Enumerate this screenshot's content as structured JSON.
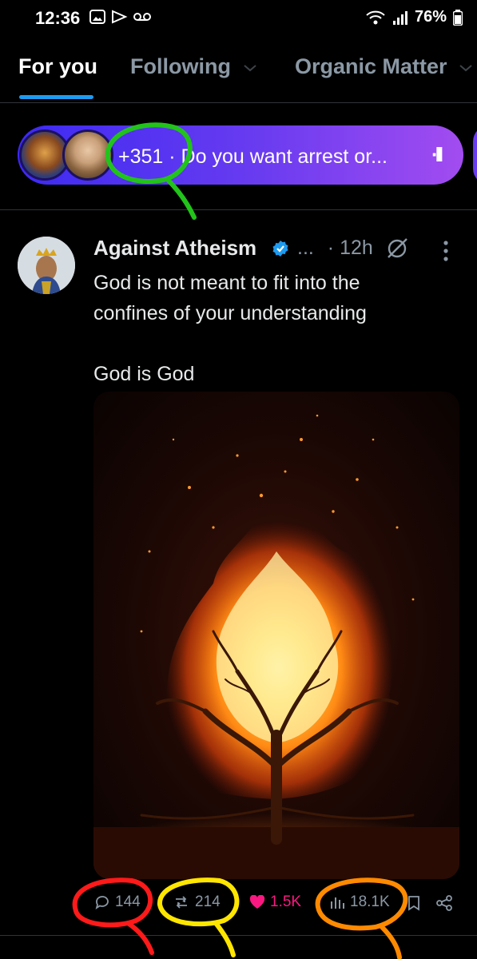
{
  "status_bar": {
    "time": "12:36",
    "battery": "76%",
    "icons": [
      "gallery-icon",
      "play-icon",
      "voicemail-icon",
      "wifi-icon",
      "signal-icon",
      "battery-icon"
    ]
  },
  "tabs": [
    {
      "label": "For you",
      "active": true
    },
    {
      "label": "Following",
      "active": false
    },
    {
      "label": "Organic Matter",
      "active": false
    }
  ],
  "space_pill": {
    "count": "+351",
    "separator": "·",
    "title": "Do you want arrest or...",
    "pause_label": "·II"
  },
  "post": {
    "author": "Against Atheism",
    "ellipsis": "...",
    "time": "· 12h",
    "text_line1": "God is not meant to fit into the",
    "text_line2": "confines of your understanding",
    "text_line3": "God is God",
    "actions": {
      "replies": "144",
      "reposts": "214",
      "likes": "1.5K",
      "views": "18.1K"
    }
  },
  "colors": {
    "accent": "#1d9bf0",
    "like": "#f91880",
    "annot_green": "#22c31a",
    "annot_red": "#ff1a1a",
    "annot_yellow": "#ffe600",
    "annot_orange": "#ff8a00"
  }
}
